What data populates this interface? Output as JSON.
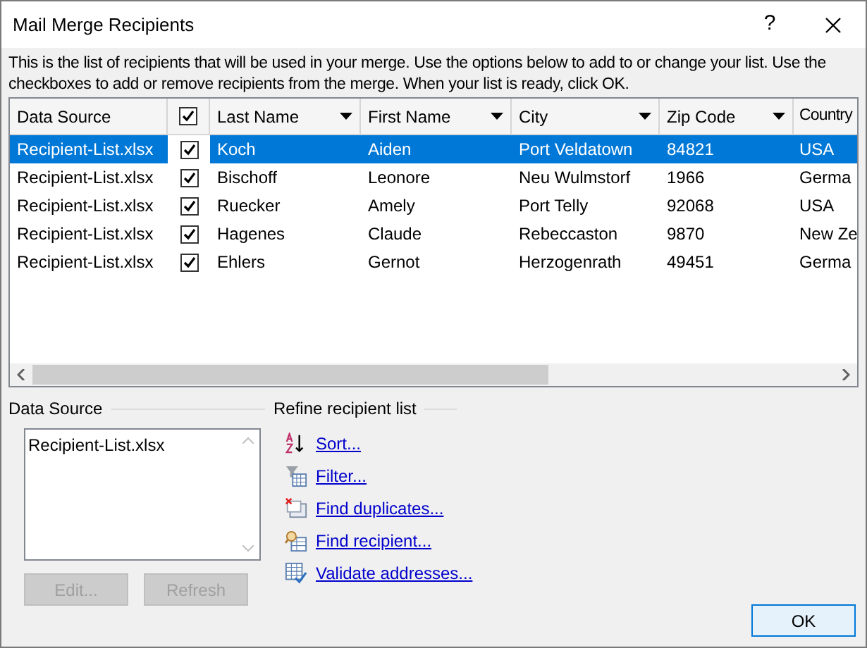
{
  "window": {
    "title": "Mail Merge Recipients",
    "help": "?"
  },
  "description": "This is the list of recipients that will be used in your merge.  Use the options below to add to or change your list.  Use the checkboxes to add or remove recipients from the merge.  When your list is ready, click OK.",
  "table": {
    "select_all_checked": true,
    "columns": [
      {
        "label": "Data Source",
        "kind": "text"
      },
      {
        "label": "Last Name",
        "kind": "sortable"
      },
      {
        "label": "First Name",
        "kind": "sortable"
      },
      {
        "label": "City",
        "kind": "sortable"
      },
      {
        "label": "Zip Code",
        "kind": "sortable"
      },
      {
        "label": "Country",
        "kind": "text"
      }
    ],
    "rows": [
      {
        "selected": true,
        "checked": true,
        "cells": [
          "Recipient-List.xlsx",
          "Koch",
          "Aiden",
          "Port Veldatown",
          "84821",
          "USA"
        ]
      },
      {
        "selected": false,
        "checked": true,
        "cells": [
          "Recipient-List.xlsx",
          "Bischoff",
          "Leonore",
          "Neu Wulmstorf",
          "1966",
          "Germa"
        ]
      },
      {
        "selected": false,
        "checked": true,
        "cells": [
          "Recipient-List.xlsx",
          "Ruecker",
          "Amely",
          "Port Telly",
          "92068",
          "USA"
        ]
      },
      {
        "selected": false,
        "checked": true,
        "cells": [
          "Recipient-List.xlsx",
          "Hagenes",
          "Claude",
          "Rebeccaston",
          "9870",
          "New Ze"
        ]
      },
      {
        "selected": false,
        "checked": true,
        "cells": [
          "Recipient-List.xlsx",
          "Ehlers",
          "Gernot",
          "Herzogenrath",
          "49451",
          "Germa"
        ]
      }
    ]
  },
  "data_source": {
    "heading": "Data Source",
    "items": [
      "Recipient-List.xlsx"
    ],
    "buttons": [
      {
        "label": "Edit...",
        "disabled": true
      },
      {
        "label": "Refresh",
        "disabled": true
      }
    ]
  },
  "refine": {
    "heading": "Refine recipient list",
    "links": [
      {
        "label": "Sort...",
        "kind": "sort"
      },
      {
        "label": "Filter...",
        "kind": "filter"
      },
      {
        "label": "Find duplicates...",
        "kind": "duplicates"
      },
      {
        "label": "Find recipient...",
        "kind": "find"
      },
      {
        "label": "Validate addresses...",
        "kind": "validate"
      }
    ]
  },
  "ok_button": "OK"
}
